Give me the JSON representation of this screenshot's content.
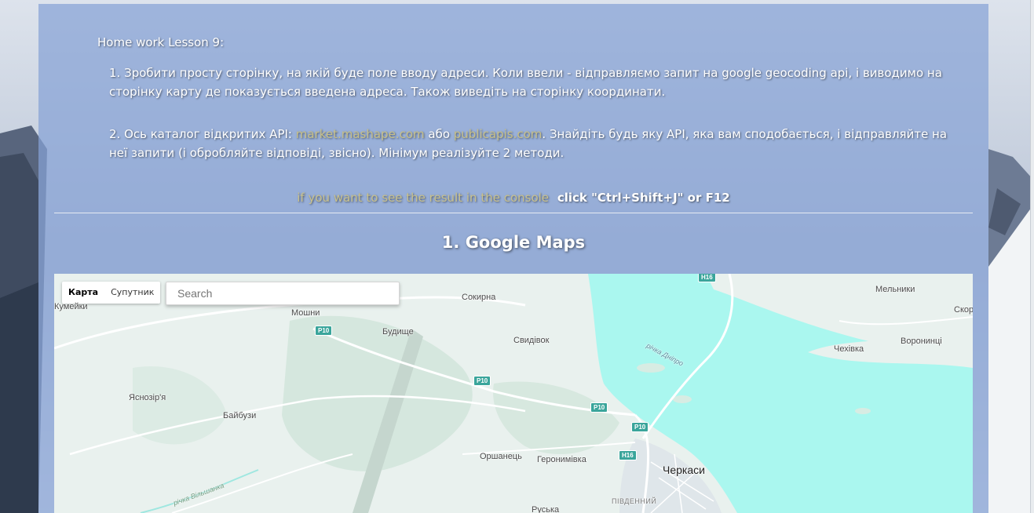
{
  "homework": {
    "title": "Home work Lesson 9:",
    "task1": "1. Зробити просту сторінку, на якій буде поле вводу адреси. Коли ввели - відправляємо запит на google geocoding api, і виводимо на сторінку карту де показується введена адреса. Також виведіть на сторінку координати.",
    "task2_prefix": "2. Ось каталог відкритих API: ",
    "task2_link1": "market.mashape.com",
    "task2_mid": " або ",
    "task2_link2": "publicapis.com",
    "task2_suffix": ". Знайдіть будь яку API, яка вам сподобається, і відправляйте на неї запити (і обробляйте відповіді, звісно). Мінімум реалізуйте 2 методи."
  },
  "console_hint": {
    "text": "if you want to see the result in the console",
    "keys": "click \"Ctrl+Shift+J\" or F12"
  },
  "section": {
    "title": "1. Google Maps"
  },
  "map": {
    "type_buttons": {
      "map": "Карта",
      "satellite": "Супутник"
    },
    "search_placeholder": "Search",
    "places": {
      "kumeiky": "Кумейки",
      "moshny": "Мошни",
      "budyshche": "Будище",
      "sokyrna": "Сокирна",
      "svydivok": "Свидівок",
      "yasnozirya": "Яснозір'я",
      "baibuzy": "Байбузи",
      "orshanets": "Оршанець",
      "heronymivka": "Геронимівка",
      "cherkasy": "Черкаси",
      "pivdennyi": "ПІВДЕННИЙ",
      "ruska": "Руська",
      "chekhivka": "Чехівка",
      "voronyntsi": "Воронинці",
      "melnyky": "Мельники",
      "skor": "Скор",
      "river_dnipro": "річка Дніпро",
      "river_vilshanka": "річка Вільшанка"
    },
    "road_shields": {
      "h16_top": "H16",
      "p10_a": "P10",
      "p10_b": "P10",
      "p10_c": "P10",
      "p10_d": "P10",
      "h16_bottom": "H16"
    },
    "colors": {
      "water": "#aaf7ef",
      "land": "#e9f1ee",
      "forest": "#d3e6dd"
    }
  }
}
